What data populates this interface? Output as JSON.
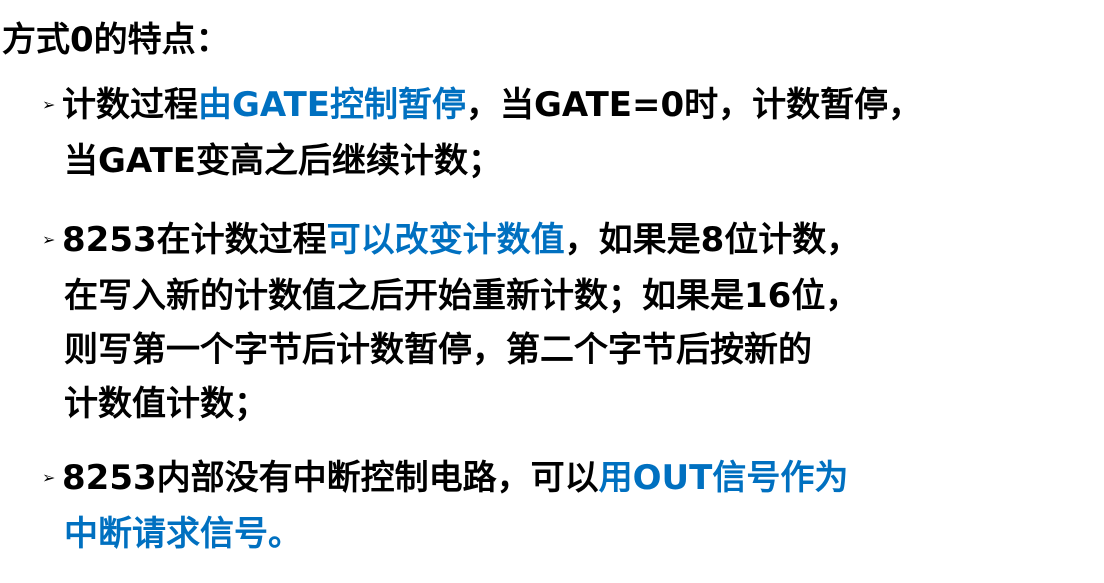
{
  "slide": {
    "heading": "方式0的特点：",
    "bullet_marker": "➢",
    "bullets": [
      {
        "lines": [
          [
            {
              "text": "计数过程",
              "highlight": false
            },
            {
              "text": "由GATE控制暂停",
              "highlight": true
            },
            {
              "text": "，当GATE=0时，计数暂停，",
              "highlight": false
            }
          ],
          [
            {
              "text": "当GATE变高之后继续计数；",
              "highlight": false
            }
          ]
        ]
      },
      {
        "lines": [
          [
            {
              "text": "8253在计数过程",
              "highlight": false
            },
            {
              "text": "可以改变计数值",
              "highlight": true
            },
            {
              "text": "，如果是8位计数，",
              "highlight": false
            }
          ],
          [
            {
              "text": "在写入新的计数值之后开始重新计数；如果是16位，",
              "highlight": false
            }
          ],
          [
            {
              "text": "则写第一个字节后计数暂停，第二个字节后按新的",
              "highlight": false
            }
          ],
          [
            {
              "text": "计数值计数；",
              "highlight": false
            }
          ]
        ]
      },
      {
        "lines": [
          [
            {
              "text": "8253内部没有中断控制电路，可以",
              "highlight": false
            },
            {
              "text": "用OUT信号作为",
              "highlight": true
            }
          ],
          [
            {
              "text": "中断请求信号。",
              "highlight": true
            }
          ]
        ]
      }
    ],
    "colors": {
      "text": "#000000",
      "highlight": "#0070c0",
      "background": "#ffffff"
    }
  }
}
